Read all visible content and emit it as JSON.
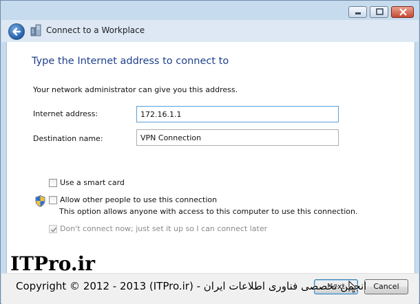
{
  "window": {
    "nav_title": "Connect to a Workplace",
    "buttons": [
      "minimize",
      "maximize",
      "close"
    ]
  },
  "main": {
    "heading": "Type the Internet address to connect to",
    "description": "Your network administrator can give you this address.",
    "internet_address_label": "Internet address:",
    "internet_address_value": "172.16.1.1",
    "destination_name_label": "Destination name:",
    "destination_name_value": "VPN Connection"
  },
  "options": {
    "smart_card": {
      "label": "Use a smart card",
      "checked": false
    },
    "allow_others": {
      "label": "Allow other people to use this connection",
      "checked": false
    },
    "allow_others_description": "This option allows anyone with access to this computer to use this connection.",
    "dont_connect": {
      "label": "Don't connect now; just set it up so I can connect later",
      "checked": true,
      "disabled": true
    }
  },
  "footer": {
    "next_label": "Next",
    "cancel_label": "Cancel"
  },
  "watermark": {
    "logo": "ITPro.ir",
    "copyright": "Copyright © 2012 - 2013 (ITPro.ir) - انجمن تخصصی فناوری اطلاعات ایران"
  },
  "icons": {
    "back": "back-arrow-icon",
    "nav": "workplace-network-icon",
    "shield": "uac-shield-icon"
  },
  "colors": {
    "heading": "#1e3f8c",
    "window_frame": "#c7dbee",
    "close_button": "#c74a33"
  }
}
